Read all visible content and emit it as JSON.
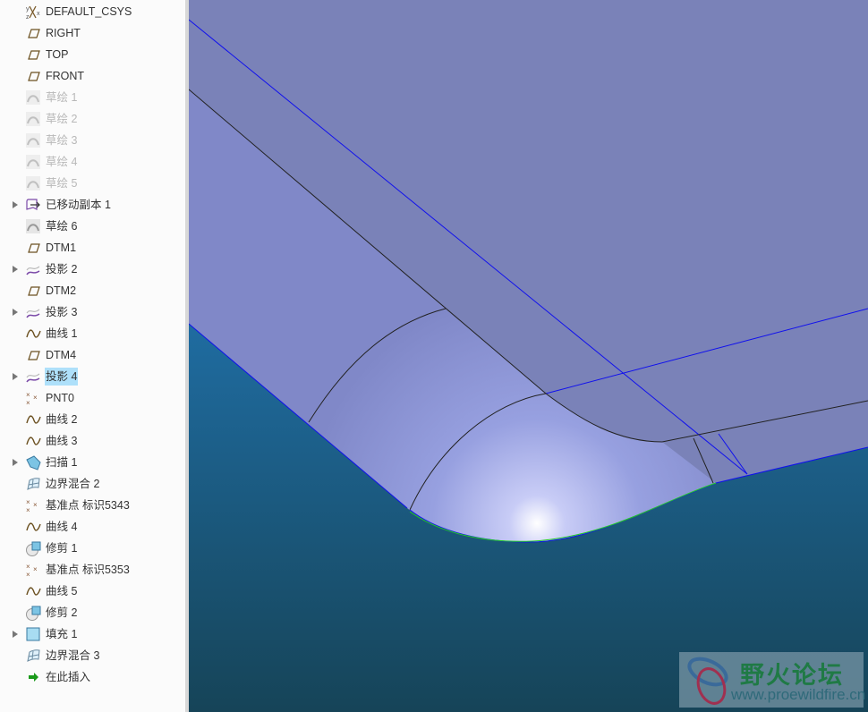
{
  "tree": {
    "items": [
      {
        "label": "DEFAULT_CSYS",
        "icon": "csys-icon",
        "expandable": false,
        "dim": false
      },
      {
        "label": "RIGHT",
        "icon": "datum-plane-icon",
        "expandable": false,
        "dim": false
      },
      {
        "label": "TOP",
        "icon": "datum-plane-icon",
        "expandable": false,
        "dim": false
      },
      {
        "label": "FRONT",
        "icon": "datum-plane-icon",
        "expandable": false,
        "dim": false
      },
      {
        "label": "草绘 1",
        "icon": "sketch-icon",
        "expandable": false,
        "dim": true
      },
      {
        "label": "草绘 2",
        "icon": "sketch-icon",
        "expandable": false,
        "dim": true
      },
      {
        "label": "草绘 3",
        "icon": "sketch-icon",
        "expandable": false,
        "dim": true
      },
      {
        "label": "草绘 4",
        "icon": "sketch-icon",
        "expandable": false,
        "dim": true
      },
      {
        "label": "草绘 5",
        "icon": "sketch-icon",
        "expandable": false,
        "dim": true
      },
      {
        "label": "已移动副本 1",
        "icon": "moved-copy-icon",
        "expandable": true,
        "dim": false
      },
      {
        "label": "草绘 6",
        "icon": "sketch-icon",
        "expandable": false,
        "dim": false
      },
      {
        "label": "DTM1",
        "icon": "datum-plane-icon",
        "expandable": false,
        "dim": false
      },
      {
        "label": "投影 2",
        "icon": "projection-icon",
        "expandable": true,
        "dim": false
      },
      {
        "label": "DTM2",
        "icon": "datum-plane-icon",
        "expandable": false,
        "dim": false
      },
      {
        "label": "投影 3",
        "icon": "projection-icon",
        "expandable": true,
        "dim": false
      },
      {
        "label": "曲线 1",
        "icon": "curve-icon",
        "expandable": false,
        "dim": false
      },
      {
        "label": "DTM4",
        "icon": "datum-plane-icon",
        "expandable": false,
        "dim": false
      },
      {
        "label": "投影 4",
        "icon": "projection-icon",
        "expandable": true,
        "dim": false,
        "selected": true
      },
      {
        "label": "PNT0",
        "icon": "datum-point-icon",
        "expandable": false,
        "dim": false
      },
      {
        "label": "曲线 2",
        "icon": "curve-icon",
        "expandable": false,
        "dim": false
      },
      {
        "label": "曲线 3",
        "icon": "curve-icon",
        "expandable": false,
        "dim": false
      },
      {
        "label": "扫描 1",
        "icon": "sweep-icon",
        "expandable": true,
        "dim": false
      },
      {
        "label": "边界混合 2",
        "icon": "boundary-blend-icon",
        "expandable": false,
        "dim": false
      },
      {
        "label": "基准点 标识5343",
        "icon": "datum-point-icon",
        "expandable": false,
        "dim": false
      },
      {
        "label": "曲线 4",
        "icon": "curve-icon",
        "expandable": false,
        "dim": false
      },
      {
        "label": "修剪 1",
        "icon": "trim-icon",
        "expandable": false,
        "dim": false
      },
      {
        "label": "基准点 标识5353",
        "icon": "datum-point-icon",
        "expandable": false,
        "dim": false
      },
      {
        "label": "曲线 5",
        "icon": "curve-icon",
        "expandable": false,
        "dim": false
      },
      {
        "label": "修剪 2",
        "icon": "trim-icon",
        "expandable": false,
        "dim": false
      },
      {
        "label": "填充 1",
        "icon": "fill-icon",
        "expandable": true,
        "dim": false
      },
      {
        "label": "边界混合 3",
        "icon": "boundary-blend-icon",
        "expandable": false,
        "dim": false
      },
      {
        "label": "在此插入",
        "icon": "insert-here-arrow-icon",
        "expandable": false,
        "dim": false
      }
    ]
  },
  "watermark": {
    "title": "野火论坛",
    "url": "www.proewildfire.cn"
  },
  "colors": {
    "selection": "#aee0fa",
    "flat_face": "#7a82b8",
    "fillet_face": "#97a0e0",
    "background_top": "#2070a8",
    "background_bottom": "#164458",
    "edge_blue": "#1010ee",
    "edge_green": "#22cc22"
  }
}
